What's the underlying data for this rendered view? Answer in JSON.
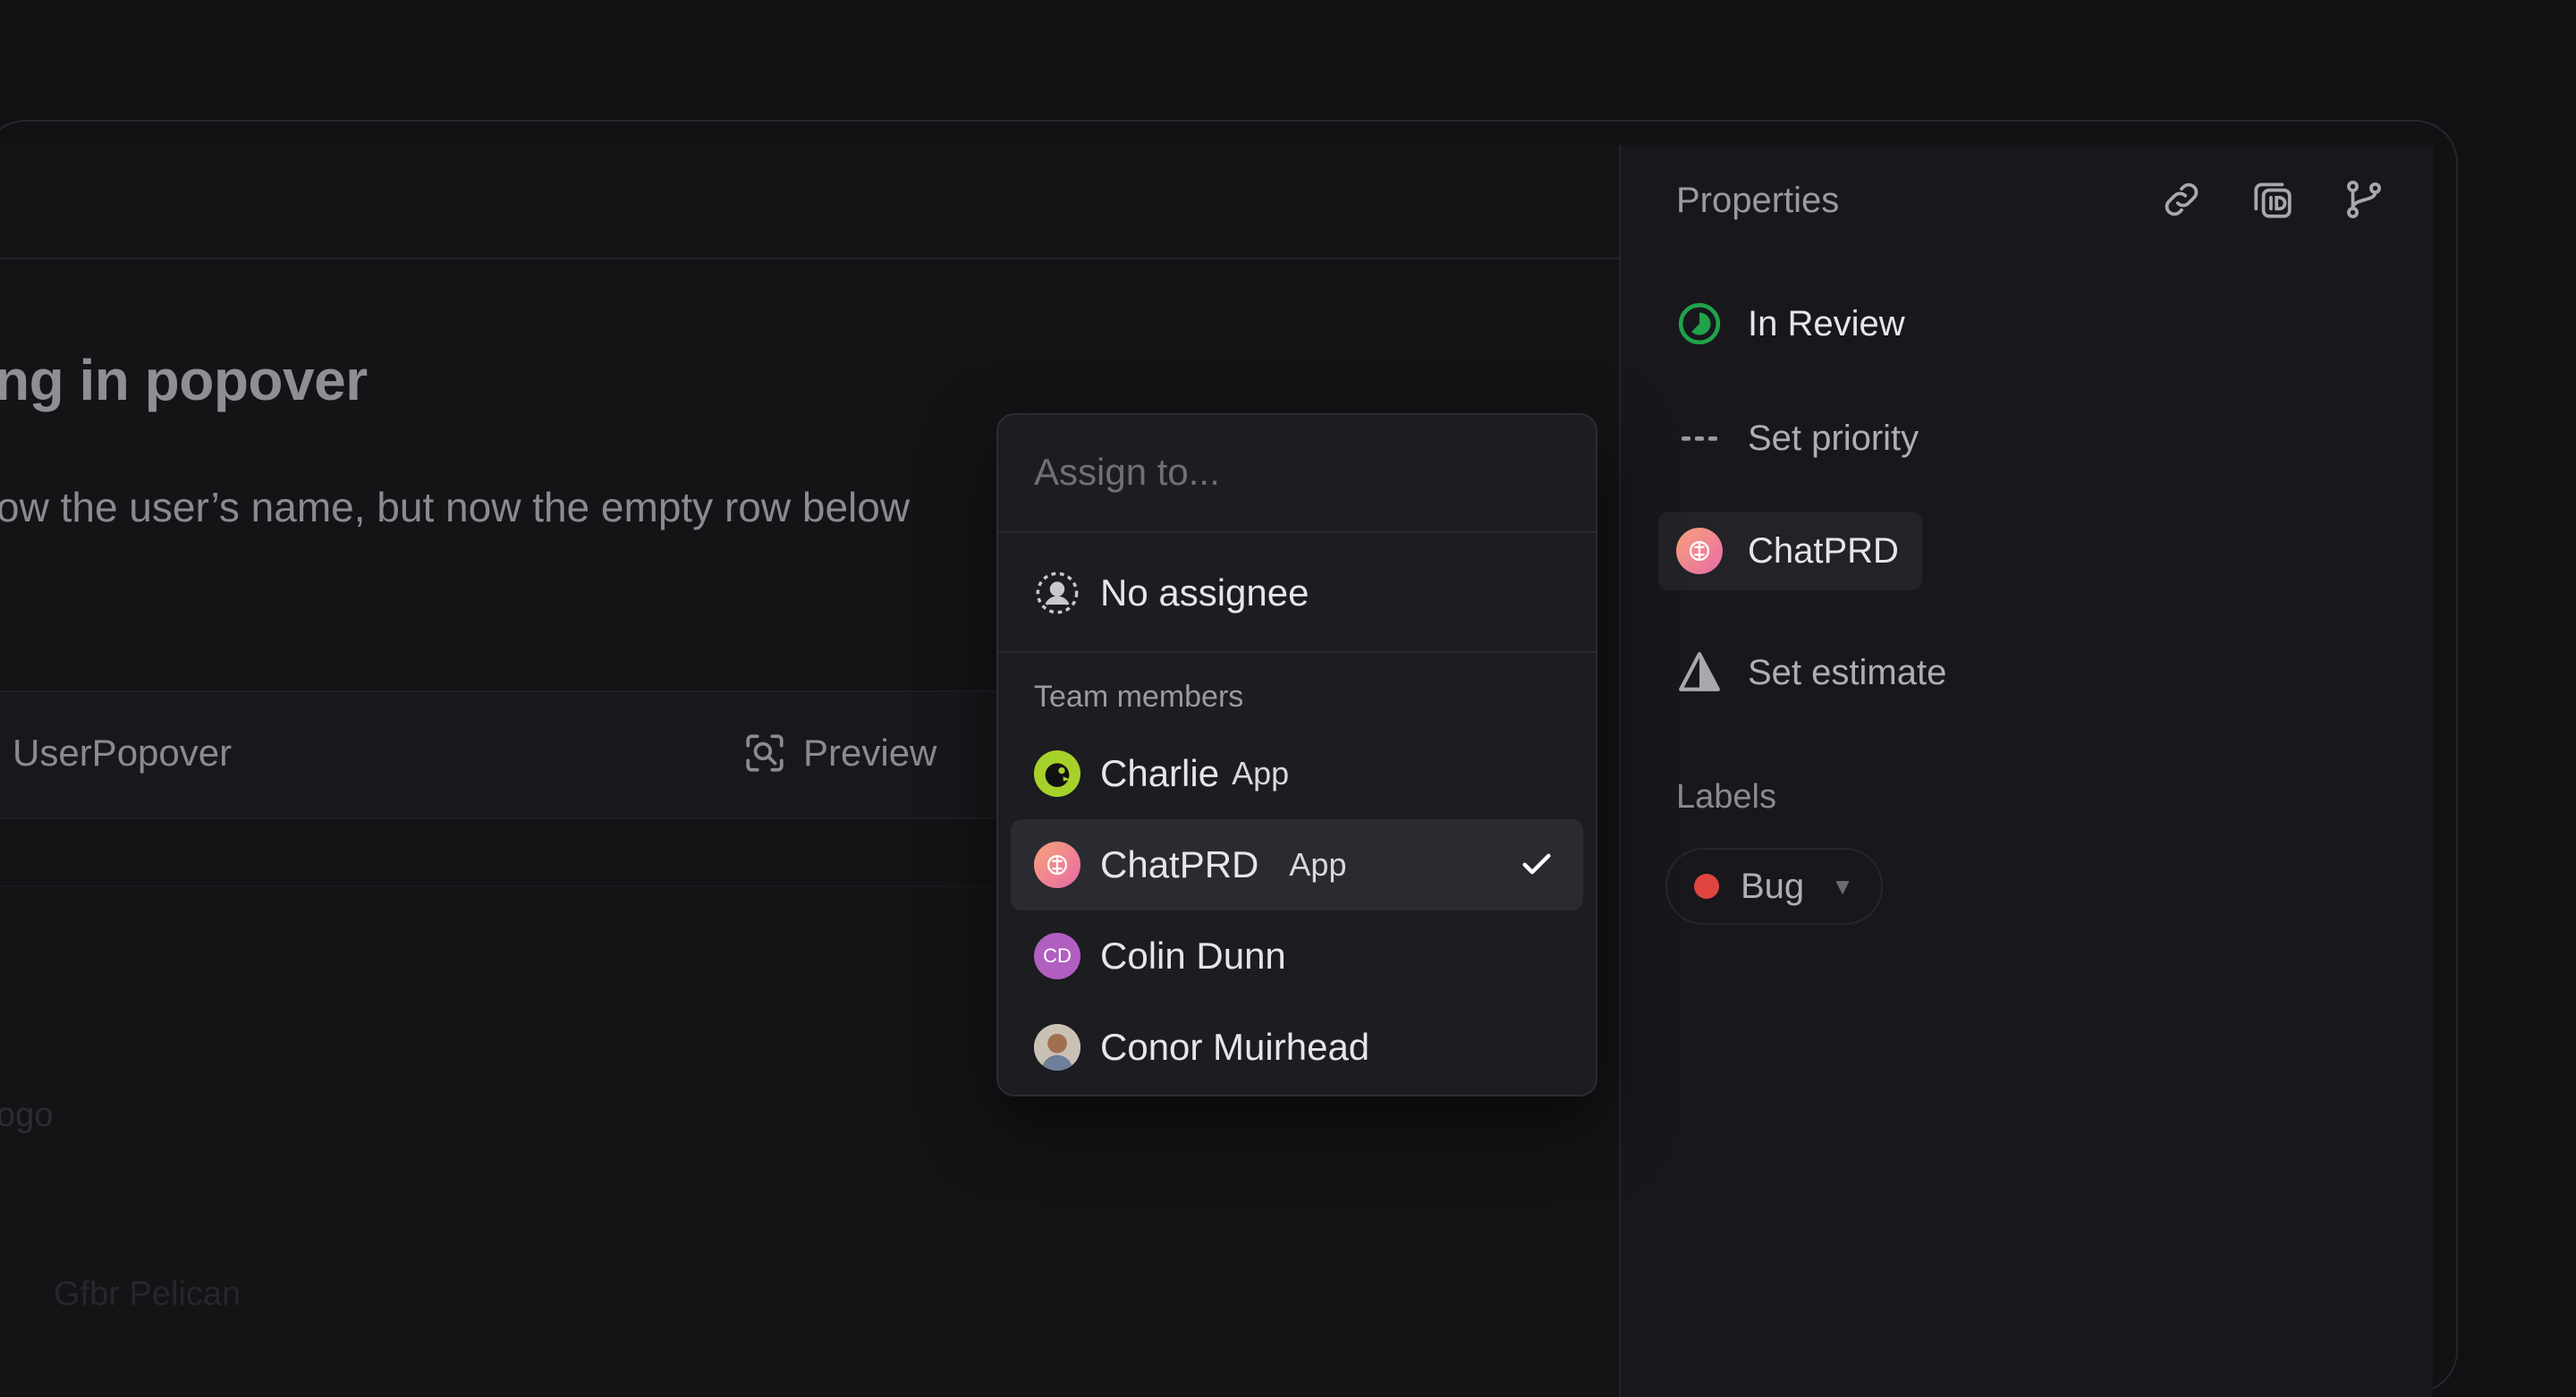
{
  "issue": {
    "title": "ng in popover",
    "desc_before": "ow the user’s name, but now the empty row below",
    "attachment_name": "UserPopover",
    "preview_label": "Preview",
    "faint_text_1": "ogo",
    "faint_text_2": "Gfbr Pelican"
  },
  "sidebar": {
    "title": "Properties",
    "status": "In Review",
    "priority": "Set priority",
    "assignee": "ChatPRD",
    "estimate": "Set estimate",
    "labels_title": "Labels",
    "label": {
      "name": "Bug",
      "color": "#e0463f"
    }
  },
  "popover": {
    "placeholder": "Assign to...",
    "no_assignee": "No assignee",
    "section": "Team members",
    "members": [
      {
        "name": "Charlie",
        "tag": "App",
        "avatar": "charlie-avatar"
      },
      {
        "name": "ChatPRD",
        "tag": "App",
        "avatar": "chatprd-avatar",
        "selected": true
      },
      {
        "name": "Colin Dunn",
        "initials": "CD",
        "avatar": "colin-avatar"
      },
      {
        "name": "Conor Muirhead",
        "avatar": "conor-avatar"
      }
    ]
  },
  "colors": {
    "status_green": "#1fa34a",
    "accent_label": "#e0463f"
  }
}
